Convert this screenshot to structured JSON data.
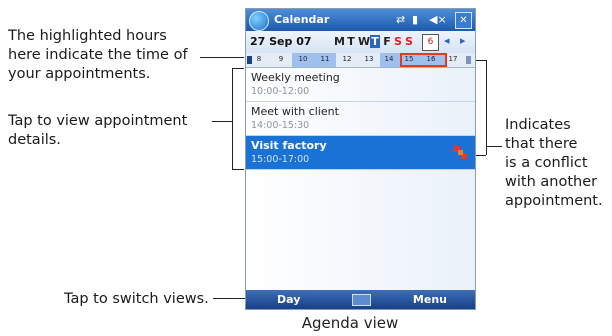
{
  "callouts": {
    "highlighted_hours_lines": [
      "The highlighted hours",
      "here indicate the time of",
      "your appointments."
    ],
    "tap_details_lines": [
      "Tap to view appointment",
      "details."
    ],
    "conflict_lines": [
      "Indicates",
      "that there",
      "is a conflict",
      "with another",
      "appointment."
    ],
    "switch_views": "Tap to switch views."
  },
  "caption": "Agenda view",
  "device": {
    "title": "Calendar",
    "date_label": "27 Sep 07",
    "weekdays": [
      "M",
      "T",
      "W",
      "T",
      "F",
      "S",
      "S"
    ],
    "selected_weekday_index": 3,
    "today_button_label": "6",
    "hour_ticks": [
      "8",
      "9",
      "10",
      "11",
      "12",
      "13",
      "14",
      "15",
      "16",
      "17"
    ],
    "appointments": [
      {
        "subject": "Weekly meeting",
        "time": "10:00-12:00",
        "selected": false,
        "conflict": false
      },
      {
        "subject": "Meet with client",
        "time": "14:00-15:30",
        "selected": false,
        "conflict": false
      },
      {
        "subject": "Visit factory",
        "time": "15:00-17:00",
        "selected": true,
        "conflict": true
      }
    ],
    "softkeys": {
      "left": "Day",
      "right": "Menu"
    },
    "colors": {
      "title_bar": "#1c59ad",
      "selected_row": "#1a73d4",
      "highlight_hours": "#9fc0ec",
      "conflict": "#e03c1d"
    }
  }
}
